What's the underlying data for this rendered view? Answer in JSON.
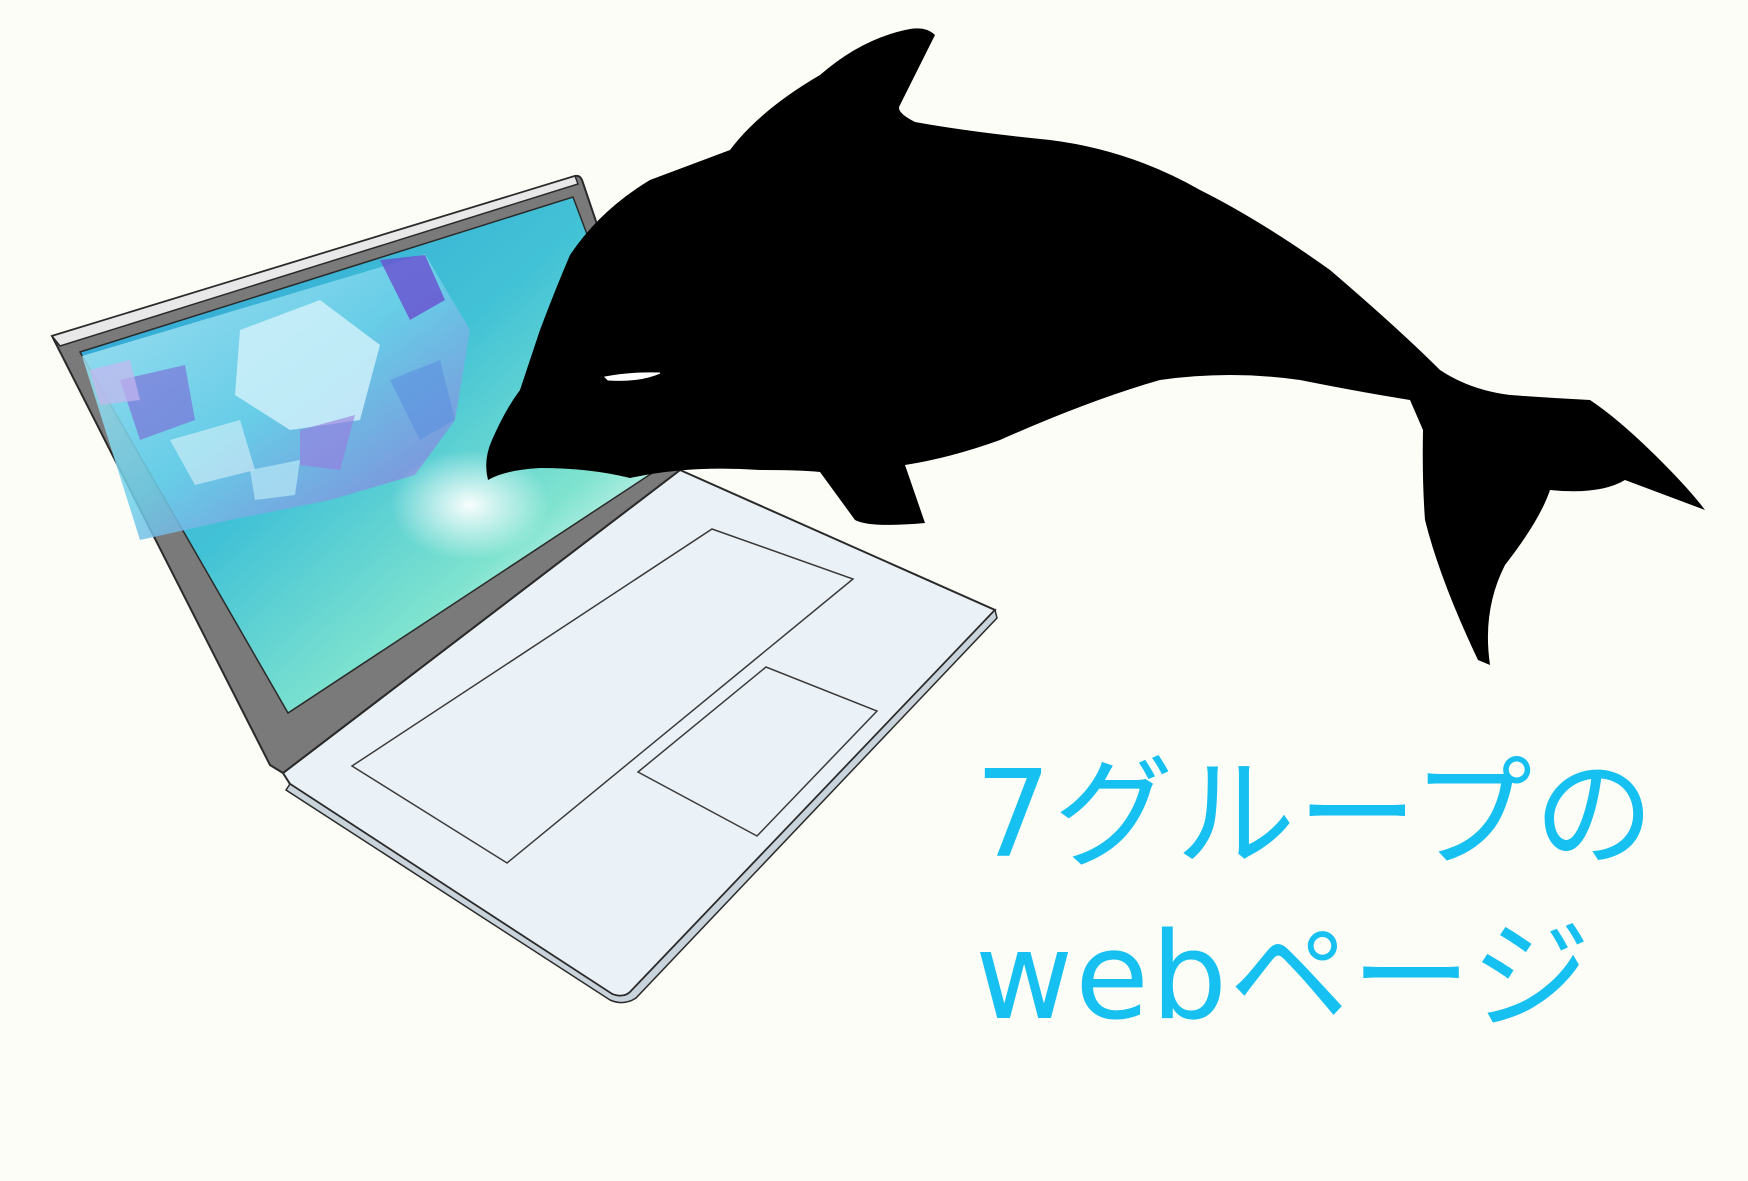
{
  "caption": {
    "line1": "7グループの",
    "line2": "webページ",
    "color": "#16c0f0"
  },
  "illustration": {
    "subject": "dolphin-leaping-from-laptop",
    "dolphin_color": "#000000",
    "laptop_base_color": "#ebf2f7",
    "screen_accent_colors": [
      "#2ea8d8",
      "#4fd6c0",
      "#8f6ad9",
      "#a6e3f5"
    ]
  },
  "background_color": "#fdfdf7"
}
